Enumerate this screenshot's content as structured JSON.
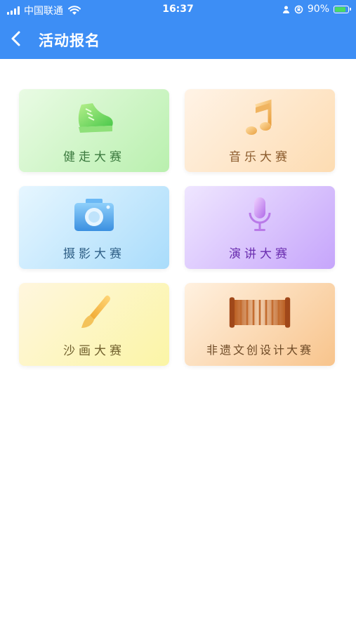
{
  "status_bar": {
    "carrier": "中国联通",
    "time": "16:37",
    "battery_percent": "90%",
    "battery_level": 0.9,
    "icons": [
      "signal-icon",
      "wifi-icon",
      "person-icon",
      "rotation-lock-icon",
      "battery-charging-icon"
    ]
  },
  "header": {
    "back_icon": "chevron-left-icon",
    "title": "活动报名"
  },
  "colors": {
    "header_bg": "#3d8ef5",
    "page_bg": "#ffffff"
  },
  "activities": [
    {
      "label": "健走大赛",
      "icon": "sneaker-icon"
    },
    {
      "label": "音乐大赛",
      "icon": "music-note-icon"
    },
    {
      "label": "摄影大赛",
      "icon": "camera-icon"
    },
    {
      "label": "演讲大赛",
      "icon": "microphone-icon"
    },
    {
      "label": "沙画大赛",
      "icon": "paintbrush-icon"
    },
    {
      "label": "非遗文创设计大赛",
      "icon": "scroll-icon"
    }
  ]
}
